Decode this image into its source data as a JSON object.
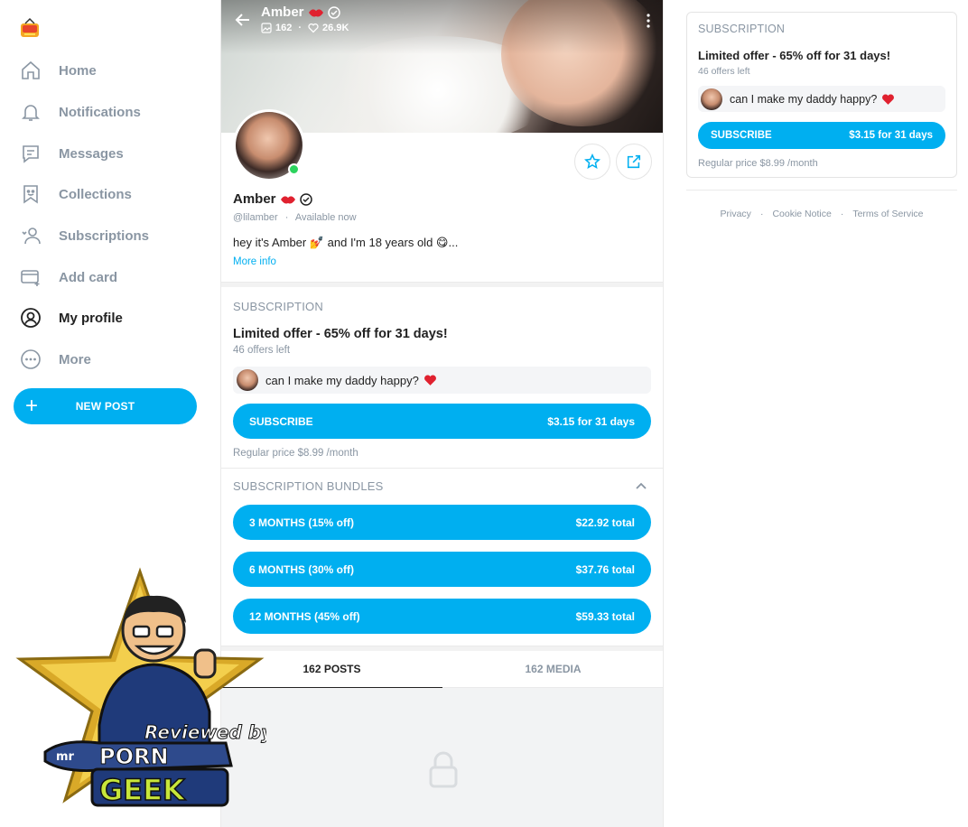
{
  "sidebar": {
    "items": [
      {
        "label": "Home",
        "icon": "home-icon"
      },
      {
        "label": "Notifications",
        "icon": "bell-icon"
      },
      {
        "label": "Messages",
        "icon": "message-icon"
      },
      {
        "label": "Collections",
        "icon": "bookmark-icon"
      },
      {
        "label": "Subscriptions",
        "icon": "user-heart-icon"
      },
      {
        "label": "Add card",
        "icon": "card-icon"
      },
      {
        "label": "My profile",
        "icon": "profile-icon",
        "active": true
      },
      {
        "label": "More",
        "icon": "more-icon"
      }
    ],
    "new_post_label": "NEW POST"
  },
  "cover": {
    "name": "Amber",
    "media_count": "162",
    "likes_count": "26.9K",
    "stats_separator": "·"
  },
  "profile": {
    "name": "Amber",
    "handle": "@lilamber",
    "status": "Available now",
    "bio": "hey it's Amber 💅 and I'm 18 years old 😋...",
    "more_info": "More info"
  },
  "subscription": {
    "section_label": "SUBSCRIPTION",
    "offer_title": "Limited offer - 65% off for 31 days!",
    "offers_left": "46 offers left",
    "message": "can I make my daddy happy?",
    "subscribe_label": "SUBSCRIBE",
    "subscribe_price": "$3.15 for 31 days",
    "regular_price": "Regular price $8.99 /month"
  },
  "bundles": {
    "section_label": "SUBSCRIPTION BUNDLES",
    "items": [
      {
        "label": "3 MONTHS (15% off)",
        "price": "$22.92 total"
      },
      {
        "label": "6 MONTHS (30% off)",
        "price": "$37.76 total"
      },
      {
        "label": "12 MONTHS (45% off)",
        "price": "$59.33 total"
      }
    ]
  },
  "tabs": [
    {
      "label": "162 POSTS",
      "active": true
    },
    {
      "label": "162 MEDIA",
      "active": false
    }
  ],
  "footer": {
    "links": [
      "Privacy",
      "Cookie Notice",
      "Terms of Service"
    ],
    "separator": "·"
  },
  "badge": {
    "line1": "Reviewed by",
    "line2": "mr",
    "line3": "PORN",
    "line4": "GEEK"
  },
  "colors": {
    "accent": "#00aff0",
    "muted": "#8a96a3",
    "online": "#2cd35d",
    "heart": "#e0212f"
  }
}
